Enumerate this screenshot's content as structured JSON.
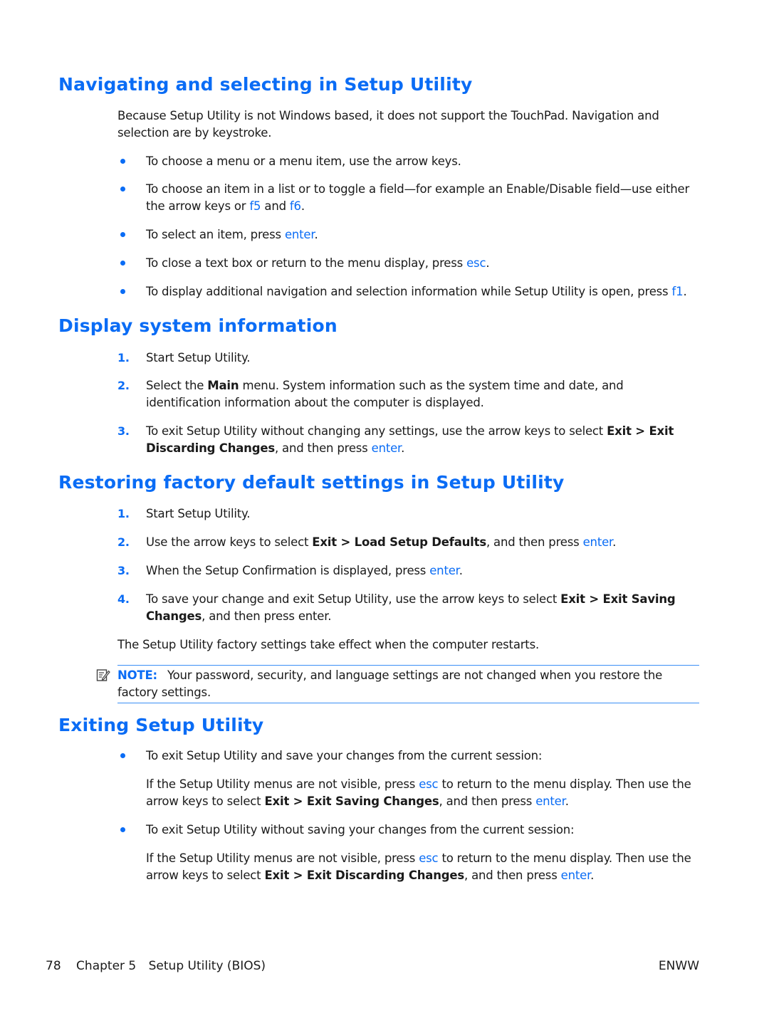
{
  "sections": [
    {
      "heading": "Navigating and selecting in Setup Utility",
      "intro": "Because Setup Utility is not Windows based, it does not support the TouchPad. Navigation and selection are by keystroke.",
      "bullets": [
        {
          "text": "To choose a menu or a menu item, use the arrow keys."
        },
        {
          "pre": "To choose an item in a list or to toggle a field—for example an Enable/Disable field—use either the arrow keys or ",
          "key1": "f5",
          "mid": " and ",
          "key2": "f6",
          "post": "."
        },
        {
          "pre": "To select an item, press ",
          "key": "enter",
          "post": "."
        },
        {
          "pre": "To close a text box or return to the menu display, press ",
          "key": "esc",
          "post": "."
        },
        {
          "pre": "To display additional navigation and selection information while Setup Utility is open, press ",
          "key": "f1",
          "post": "."
        }
      ]
    },
    {
      "heading": "Display system information",
      "steps": [
        {
          "num": "1.",
          "text": "Start Setup Utility."
        },
        {
          "num": "2.",
          "pre": "Select the ",
          "bold": "Main",
          "post": " menu. System information such as the system time and date, and identification information about the computer is displayed."
        },
        {
          "num": "3.",
          "pre": "To exit Setup Utility without changing any settings, use the arrow keys to select ",
          "bold": "Exit > Exit Discarding Changes",
          "mid": ", and then press ",
          "key": "enter",
          "post": "."
        }
      ]
    },
    {
      "heading": "Restoring factory default settings in Setup Utility",
      "steps": [
        {
          "num": "1.",
          "text": "Start Setup Utility."
        },
        {
          "num": "2.",
          "pre": "Use the arrow keys to select ",
          "bold": "Exit > Load Setup Defaults",
          "mid": ", and then press ",
          "key": "enter",
          "post": "."
        },
        {
          "num": "3.",
          "pre": "When the Setup Confirmation is displayed, press ",
          "key": "enter",
          "post": "."
        },
        {
          "num": "4.",
          "pre": "To save your change and exit Setup Utility, use the arrow keys to select ",
          "bold": "Exit > Exit Saving Changes",
          "post": ", and then press enter."
        }
      ],
      "outro": "The Setup Utility factory settings take effect when the computer restarts.",
      "note": {
        "icon": "note-pencil-icon",
        "label": "NOTE:",
        "text": "Your password, security, and language settings are not changed when you restore the factory settings."
      }
    },
    {
      "heading": "Exiting Setup Utility",
      "bullets": [
        {
          "text": "To exit Setup Utility and save your changes from the current session:",
          "sub": {
            "pre": "If the Setup Utility menus are not visible, press ",
            "key": "esc",
            "mid": " to return to the menu display. Then use the arrow keys to select ",
            "bold": "Exit > Exit Saving Changes",
            "mid2": ", and then press ",
            "key2": "enter",
            "post": "."
          }
        },
        {
          "text": "To exit Setup Utility without saving your changes from the current session:",
          "sub": {
            "pre": "If the Setup Utility menus are not visible, press ",
            "key": "esc",
            "mid": " to return to the menu display. Then use the arrow keys to select ",
            "bold": "Exit > Exit Discarding Changes",
            "mid2": ", and then press ",
            "key2": "enter",
            "post": "."
          }
        }
      ]
    }
  ],
  "footer": {
    "page_number": "78",
    "chapter": "Chapter 5",
    "chapter_title": "Setup Utility (BIOS)",
    "locale": "ENWW"
  },
  "colors": {
    "accent": "#0a6cf5",
    "text": "#1a1a1a"
  }
}
